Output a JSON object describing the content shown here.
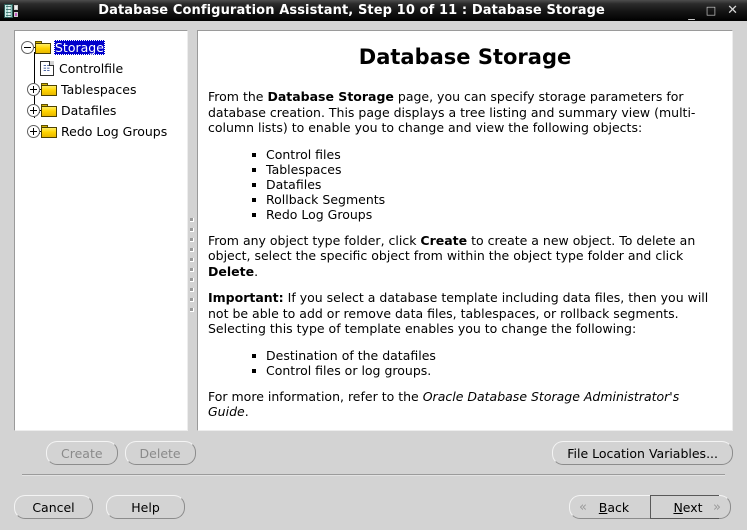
{
  "window": {
    "title": "Database Configuration Assistant, Step 10 of 11 : Database Storage",
    "icon": "database-app-icon",
    "minimize": "_",
    "maximize": "□",
    "close": "✕"
  },
  "tree": {
    "root": {
      "label": "Storage",
      "selected": true,
      "expanded": true,
      "handle": "−"
    },
    "children": [
      {
        "label": "Controlfile",
        "icon": "document-icon",
        "expandable": false
      },
      {
        "label": "Tablespaces",
        "icon": "folder-icon",
        "expandable": true,
        "handle": "+"
      },
      {
        "label": "Datafiles",
        "icon": "folder-icon",
        "expandable": true,
        "handle": "+"
      },
      {
        "label": "Redo Log Groups",
        "icon": "folder-icon",
        "expandable": true,
        "handle": "+"
      }
    ]
  },
  "main": {
    "heading": "Database Storage",
    "paragraph1": {
      "pre": "From the ",
      "bold": "Database Storage",
      "post": " page, you can specify storage parameters for database creation. This page displays a tree listing and summary view (multi-column lists) to enable you to change and view the following objects:"
    },
    "object_list": [
      "Control files",
      "Tablespaces",
      "Datafiles",
      "Rollback Segments",
      "Redo Log Groups"
    ],
    "paragraph2": {
      "pre": "From any object type folder, click ",
      "bold1": "Create",
      "mid": " to create a new object. To delete an object, select the specific object from within the object type folder and click ",
      "bold2": "Delete",
      "post": "."
    },
    "paragraph3": {
      "bold": "Important:",
      "text": " If you select a database template including data files, then you will not be able to add or remove data files, tablespaces, or rollback segments. Selecting this type of template enables you to change the following:"
    },
    "change_list": [
      "Destination of the datafiles",
      "Control files or log groups."
    ],
    "paragraph4": {
      "pre": "For more information, refer to the ",
      "italic": "Oracle Database Storage Administrator's Guide",
      "post": "."
    }
  },
  "toolbar": {
    "create_label": "Create",
    "create_enabled": false,
    "delete_label": "Delete",
    "delete_enabled": false,
    "file_location_label": "File Location Variables..."
  },
  "footer": {
    "cancel_label": "Cancel",
    "help_label": "Help",
    "back_label": "Back",
    "back_mnemonic": "B",
    "back_chevron": "«",
    "next_label": "Next",
    "next_mnemonic": "N",
    "next_chevron": "»"
  },
  "colors": {
    "window_bg": "#d3d3d3",
    "panel_bg": "#ffffff",
    "selection": "#0000cc",
    "folder": "#ffd400",
    "titlebar": "#141414"
  }
}
